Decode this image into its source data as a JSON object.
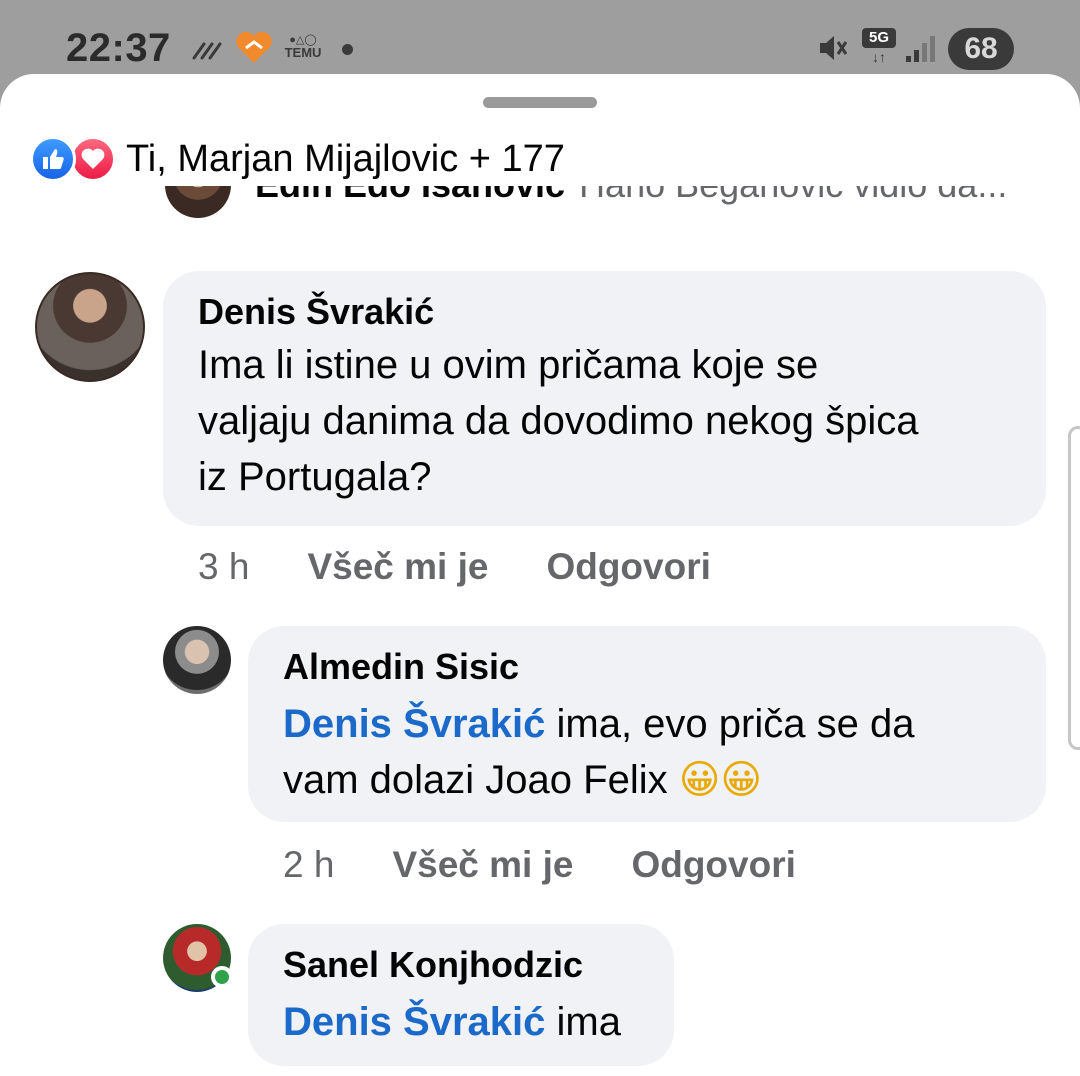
{
  "status_bar": {
    "time": "22:37",
    "app_label": "TEMU",
    "network": "5G",
    "battery": "68",
    "icons": [
      "wavy-lines-icon",
      "heart-app-icon",
      "temu-icon",
      "dot-icon",
      "mute-icon",
      "5g-icon",
      "signal-icon",
      "battery-icon"
    ]
  },
  "reactions": {
    "icons": [
      "like-icon",
      "love-icon"
    ],
    "text": "Ti, Marjan Mijajlovic + 177"
  },
  "clipped_comment": {
    "name": "Edin Edo Isanovic",
    "text": "Hano Beganovic vidio da..."
  },
  "comments": [
    {
      "author": "Denis Švrakić",
      "lines": [
        "Ima li istine u ovim pričama koje se",
        "valjaju danima da dovodimo nekog špica",
        "iz Portugala?"
      ],
      "time": "3 h",
      "like": "Všeč mi je",
      "reply": "Odgovori"
    },
    {
      "author": "Almedin Sisic",
      "mention": "Denis Švrakić",
      "line1_rest": " ima, evo priča se da",
      "line2": "vam dolazi Joao Felix",
      "emoji": "😀😀",
      "time": "2 h",
      "like": "Všeč mi je",
      "reply": "Odgovori"
    },
    {
      "author": "Sanel Konjhodzic",
      "mention": "Denis Švrakić",
      "rest": " ima"
    }
  ],
  "colors": {
    "mention": "#1b6ac9",
    "bubble": "#f0f2f5",
    "meta": "#65676b",
    "online": "#31a24c"
  }
}
